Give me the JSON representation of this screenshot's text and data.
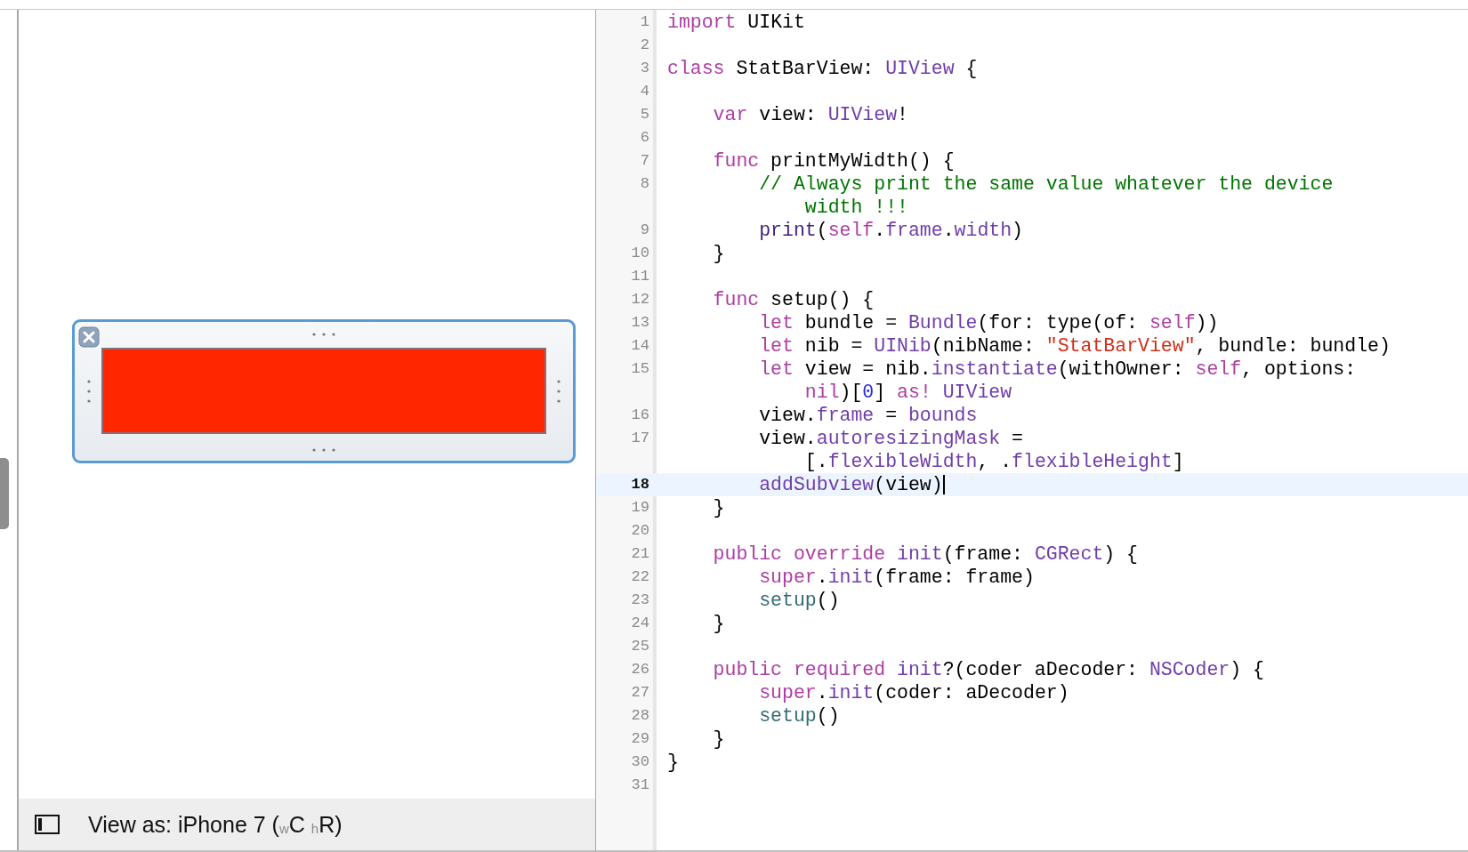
{
  "canvas": {
    "view_label": "View as: iPhone 7 ($_{w}$C $_{h}$R)"
  },
  "editor": {
    "lines": [
      {
        "number": "1",
        "current": false,
        "tokens": [
          {
            "kind": "kw",
            "text": "import"
          },
          {
            "kind": "p",
            "text": " UIKit"
          }
        ]
      },
      {
        "number": "2",
        "current": false
      },
      {
        "number": "3",
        "current": false,
        "tokens": [
          {
            "kind": "kw",
            "text": "class"
          },
          {
            "kind": "p",
            "text": " StatBarView: "
          },
          {
            "kind": "ty",
            "text": "UIView"
          },
          {
            "kind": "p",
            "text": " {"
          }
        ]
      },
      {
        "number": "4",
        "current": false
      },
      {
        "number": "5",
        "current": false,
        "tokens": [
          {
            "kind": "kw",
            "text": "    var"
          },
          {
            "kind": "p",
            "text": " view: "
          },
          {
            "kind": "ty",
            "text": "UIView"
          },
          {
            "kind": "p",
            "text": "!"
          }
        ]
      },
      {
        "number": "6",
        "current": false
      },
      {
        "number": "7",
        "current": false,
        "tokens": [
          {
            "kind": "kw",
            "text": "    func"
          },
          {
            "kind": "p",
            "text": " printMyWidth() {"
          }
        ]
      },
      {
        "number": "8",
        "current": false,
        "tokens": [
          {
            "kind": "co",
            "text": "        // Always print the same value whatever the device"
          }
        ],
        "continuation": [
          {
            "kind": "co",
            "text": "            width !!!"
          }
        ]
      },
      {
        "number": "9",
        "current": false,
        "tokens": [
          {
            "kind": "fn",
            "text": "        print"
          },
          {
            "kind": "p",
            "text": "("
          },
          {
            "kind": "kw",
            "text": "self"
          },
          {
            "kind": "p",
            "text": "."
          },
          {
            "kind": "mb",
            "text": "frame"
          },
          {
            "kind": "p",
            "text": "."
          },
          {
            "kind": "mb",
            "text": "width"
          },
          {
            "kind": "p",
            "text": ")"
          }
        ]
      },
      {
        "number": "10",
        "current": false,
        "tokens": [
          {
            "kind": "p",
            "text": "    }"
          }
        ]
      },
      {
        "number": "11",
        "current": false
      },
      {
        "number": "12",
        "current": false,
        "tokens": [
          {
            "kind": "kw",
            "text": "    func"
          },
          {
            "kind": "p",
            "text": " setup() {"
          }
        ]
      },
      {
        "number": "13",
        "current": false,
        "tokens": [
          {
            "kind": "kw",
            "text": "        let"
          },
          {
            "kind": "p",
            "text": " bundle = "
          },
          {
            "kind": "ty",
            "text": "Bundle"
          },
          {
            "kind": "p",
            "text": "(for: type(of: "
          },
          {
            "kind": "kw",
            "text": "self"
          },
          {
            "kind": "p",
            "text": "))"
          }
        ]
      },
      {
        "number": "14",
        "current": false,
        "tokens": [
          {
            "kind": "kw",
            "text": "        let"
          },
          {
            "kind": "p",
            "text": " nib = "
          },
          {
            "kind": "ty",
            "text": "UINib"
          },
          {
            "kind": "p",
            "text": "(nibName: "
          },
          {
            "kind": "st",
            "text": "\"StatBarView\""
          },
          {
            "kind": "p",
            "text": ", bundle: bundle)"
          }
        ]
      },
      {
        "number": "15",
        "current": false,
        "tokens": [
          {
            "kind": "kw",
            "text": "        let"
          },
          {
            "kind": "p",
            "text": " view = nib."
          },
          {
            "kind": "mb",
            "text": "instantiate"
          },
          {
            "kind": "p",
            "text": "(withOwner: "
          },
          {
            "kind": "kw",
            "text": "self"
          },
          {
            "kind": "p",
            "text": ", options:"
          }
        ],
        "continuation": [
          {
            "kind": "kw",
            "text": "            nil"
          },
          {
            "kind": "p",
            "text": ")["
          },
          {
            "kind": "nu",
            "text": "0"
          },
          {
            "kind": "p",
            "text": "] "
          },
          {
            "kind": "kw",
            "text": "as!"
          },
          {
            "kind": "ty",
            "text": " UIView"
          }
        ]
      },
      {
        "number": "16",
        "current": false,
        "tokens": [
          {
            "kind": "p",
            "text": "        view."
          },
          {
            "kind": "mb",
            "text": "frame"
          },
          {
            "kind": "p",
            "text": " = "
          },
          {
            "kind": "mb",
            "text": "bounds"
          }
        ]
      },
      {
        "number": "17",
        "current": false,
        "tokens": [
          {
            "kind": "p",
            "text": "        view."
          },
          {
            "kind": "mb",
            "text": "autoresizingMask"
          },
          {
            "kind": "p",
            "text": " ="
          }
        ],
        "continuation": [
          {
            "kind": "p",
            "text": "            [."
          },
          {
            "kind": "mb",
            "text": "flexibleWidth"
          },
          {
            "kind": "p",
            "text": ", ."
          },
          {
            "kind": "mb",
            "text": "flexibleHeight"
          },
          {
            "kind": "p",
            "text": "]"
          }
        ]
      },
      {
        "number": "18",
        "current": true,
        "tokens": [
          {
            "kind": "mb",
            "text": "        addSubview"
          },
          {
            "kind": "p",
            "text": "(view)"
          }
        ]
      },
      {
        "number": "19",
        "current": false,
        "tokens": [
          {
            "kind": "p",
            "text": "    }"
          }
        ]
      },
      {
        "number": "20",
        "current": false
      },
      {
        "number": "21",
        "current": false,
        "tokens": [
          {
            "kind": "kw",
            "text": "    public override"
          },
          {
            "kind": "mb",
            "text": " init"
          },
          {
            "kind": "p",
            "text": "(frame: "
          },
          {
            "kind": "ty",
            "text": "CGRect"
          },
          {
            "kind": "p",
            "text": ") {"
          }
        ]
      },
      {
        "number": "22",
        "current": false,
        "tokens": [
          {
            "kind": "kw",
            "text": "        super"
          },
          {
            "kind": "p",
            "text": "."
          },
          {
            "kind": "mb",
            "text": "init"
          },
          {
            "kind": "p",
            "text": "(frame: frame)"
          }
        ]
      },
      {
        "number": "23",
        "current": false,
        "tokens": [
          {
            "kind": "pr",
            "text": "        setup"
          },
          {
            "kind": "p",
            "text": "()"
          }
        ]
      },
      {
        "number": "24",
        "current": false,
        "tokens": [
          {
            "kind": "p",
            "text": "    }"
          }
        ]
      },
      {
        "number": "25",
        "current": false
      },
      {
        "number": "26",
        "current": false,
        "tokens": [
          {
            "kind": "kw",
            "text": "    public required"
          },
          {
            "kind": "mb",
            "text": " init"
          },
          {
            "kind": "p",
            "text": "?(coder aDecoder: "
          },
          {
            "kind": "ty",
            "text": "NSCoder"
          },
          {
            "kind": "p",
            "text": ") {"
          }
        ]
      },
      {
        "number": "27",
        "current": false,
        "tokens": [
          {
            "kind": "kw",
            "text": "        super"
          },
          {
            "kind": "p",
            "text": "."
          },
          {
            "kind": "mb",
            "text": "init"
          },
          {
            "kind": "p",
            "text": "(coder: aDecoder)"
          }
        ]
      },
      {
        "number": "28",
        "current": false,
        "tokens": [
          {
            "kind": "pr",
            "text": "        setup"
          },
          {
            "kind": "p",
            "text": "()"
          }
        ]
      },
      {
        "number": "29",
        "current": false,
        "tokens": [
          {
            "kind": "p",
            "text": "    }"
          }
        ]
      },
      {
        "number": "30",
        "current": false,
        "tokens": [
          {
            "kind": "p",
            "text": "}"
          }
        ]
      },
      {
        "number": "31",
        "current": false
      }
    ]
  }
}
